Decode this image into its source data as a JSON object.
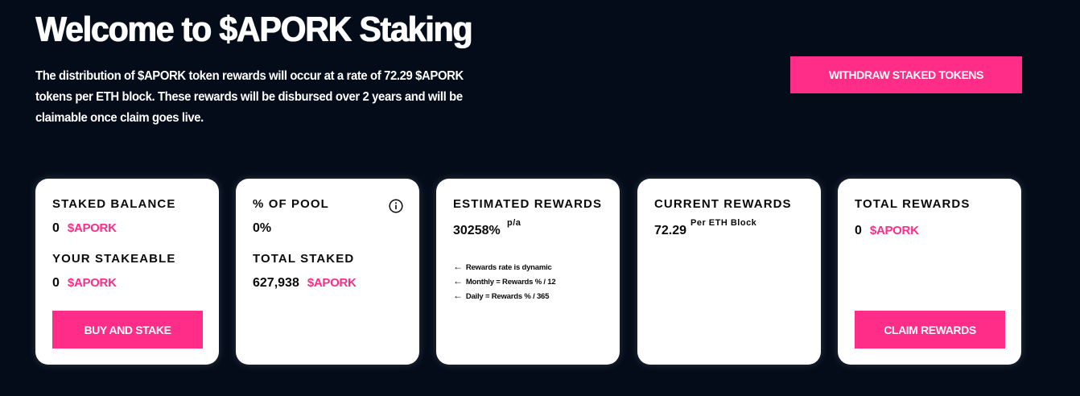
{
  "header": {
    "title": "Welcome to $APORK Staking",
    "description": "The distribution of $APORK token rewards will occur at a rate of 72.29 $APORK tokens per ETH block. These rewards will be disbursed over 2 years and will be claimable once claim goes live.",
    "withdraw_label": "WITHDRAW STAKED TOKENS"
  },
  "colors": {
    "background": "#040c1a",
    "accent": "#ff2d87",
    "card": "#ffffff"
  },
  "token_symbol": "$APORK",
  "cards": {
    "staked": {
      "label": "STAKED BALANCE",
      "value": "0",
      "token": "$APORK",
      "stakeable_label": "YOUR STAKEABLE",
      "stakeable_value": "0",
      "stakeable_token": "$APORK",
      "button_label": "BUY AND STAKE"
    },
    "pool": {
      "label": "% OF POOL",
      "value": "0%",
      "info_icon": "info-icon",
      "total_label": "TOTAL STAKED",
      "total_value": "627,938",
      "total_token": "$APORK"
    },
    "estimated": {
      "label": "ESTIMATED REWARDS",
      "value": "30258%",
      "unit": "p/a",
      "notes": [
        {
          "icon": "arrow-left-icon",
          "text": "Rewards rate is dynamic"
        },
        {
          "icon": "arrow-left-icon",
          "text": "Monthly = Rewards % / 12"
        },
        {
          "icon": "arrow-left-icon",
          "text": "Daily = Rewards % / 365"
        }
      ]
    },
    "current": {
      "label": "CURRENT REWARDS",
      "value": "72.29",
      "unit": "Per ETH Block"
    },
    "total": {
      "label": "TOTAL REWARDS",
      "value": "0",
      "token": "$APORK",
      "button_label": "CLAIM REWARDS"
    }
  }
}
